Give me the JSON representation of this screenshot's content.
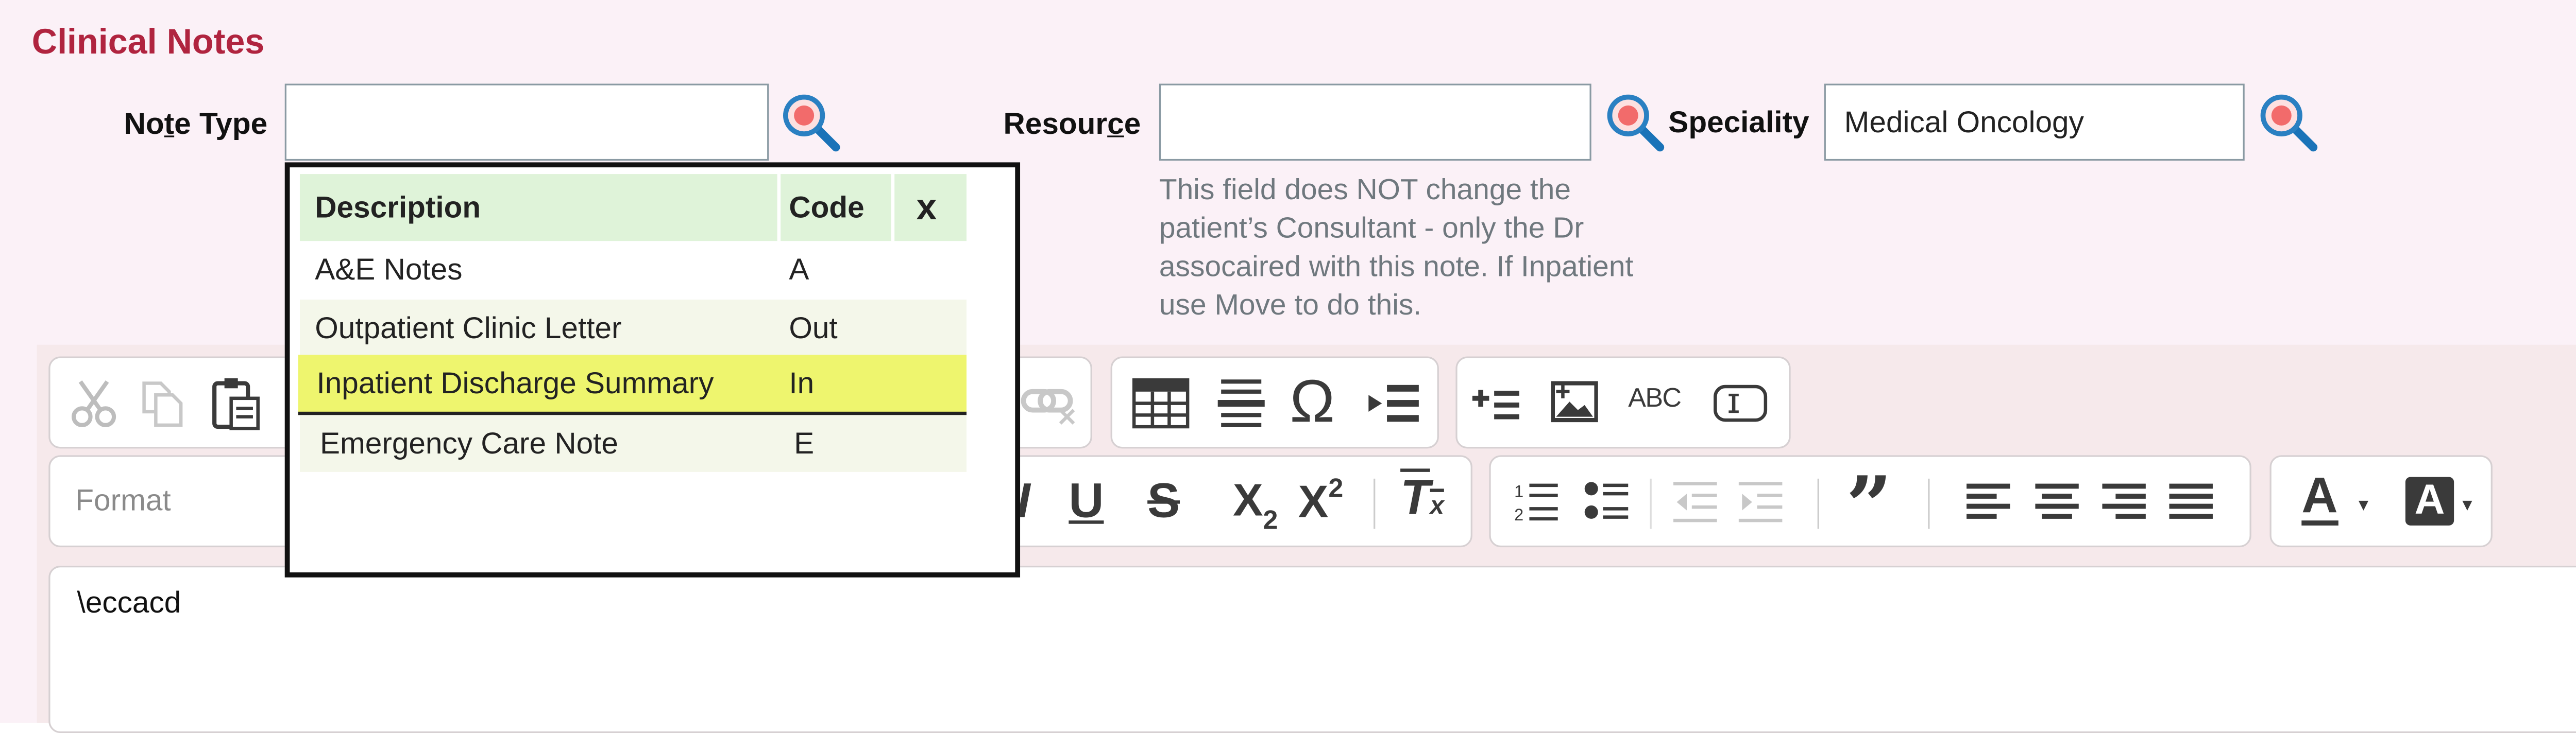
{
  "title": "Clinical Notes",
  "fields": {
    "note_type": {
      "label_pre": "No",
      "label_u": "t",
      "label_post": "e Type",
      "value": ""
    },
    "resource": {
      "label_pre": "Resour",
      "label_u": "c",
      "label_post": "e",
      "value": ""
    },
    "speciality": {
      "label": "Speciality",
      "value": "Medical Oncology"
    }
  },
  "resource_hint": "This field does NOT change the patient’s Consultant - only the Dr assocaired with this note. If Inpatient use Move to do this.",
  "lookup": {
    "headers": {
      "description": "Description",
      "code": "Code",
      "close": "x"
    },
    "rows": [
      {
        "description": "A&E Notes",
        "code": "A"
      },
      {
        "description": "Outpatient Clinic Letter",
        "code": "Out"
      },
      {
        "description": "Inpatient Discharge Summary",
        "code": "In"
      },
      {
        "description": "Emergency Care Note",
        "code": "E"
      }
    ],
    "selected_index": 2
  },
  "editor": {
    "format_placeholder": "Format",
    "content": "\\eccacd",
    "toolbar_text": {
      "abc": "ABC"
    }
  },
  "colors": {
    "title": "#b0243f",
    "selected_row": "#eef56e",
    "header_row": "#dff3d9",
    "background": "#fbf1f7"
  },
  "icons": [
    "cut-icon",
    "copy-icon",
    "paste-icon",
    "unlink-icon",
    "table-icon",
    "horizontal-rule-icon",
    "special-char-icon",
    "indent-block-icon",
    "insert-list-icon",
    "image-icon",
    "spellcheck-icon",
    "textfield-icon",
    "italic-icon",
    "underline-icon",
    "strikethrough-icon",
    "subscript-icon",
    "superscript-icon",
    "remove-format-icon",
    "numbered-list-icon",
    "bullet-list-icon",
    "outdent-icon",
    "indent-icon",
    "blockquote-icon",
    "align-left-icon",
    "align-center-icon",
    "align-right-icon",
    "justify-icon",
    "text-color-icon",
    "background-color-icon",
    "search-icon"
  ]
}
